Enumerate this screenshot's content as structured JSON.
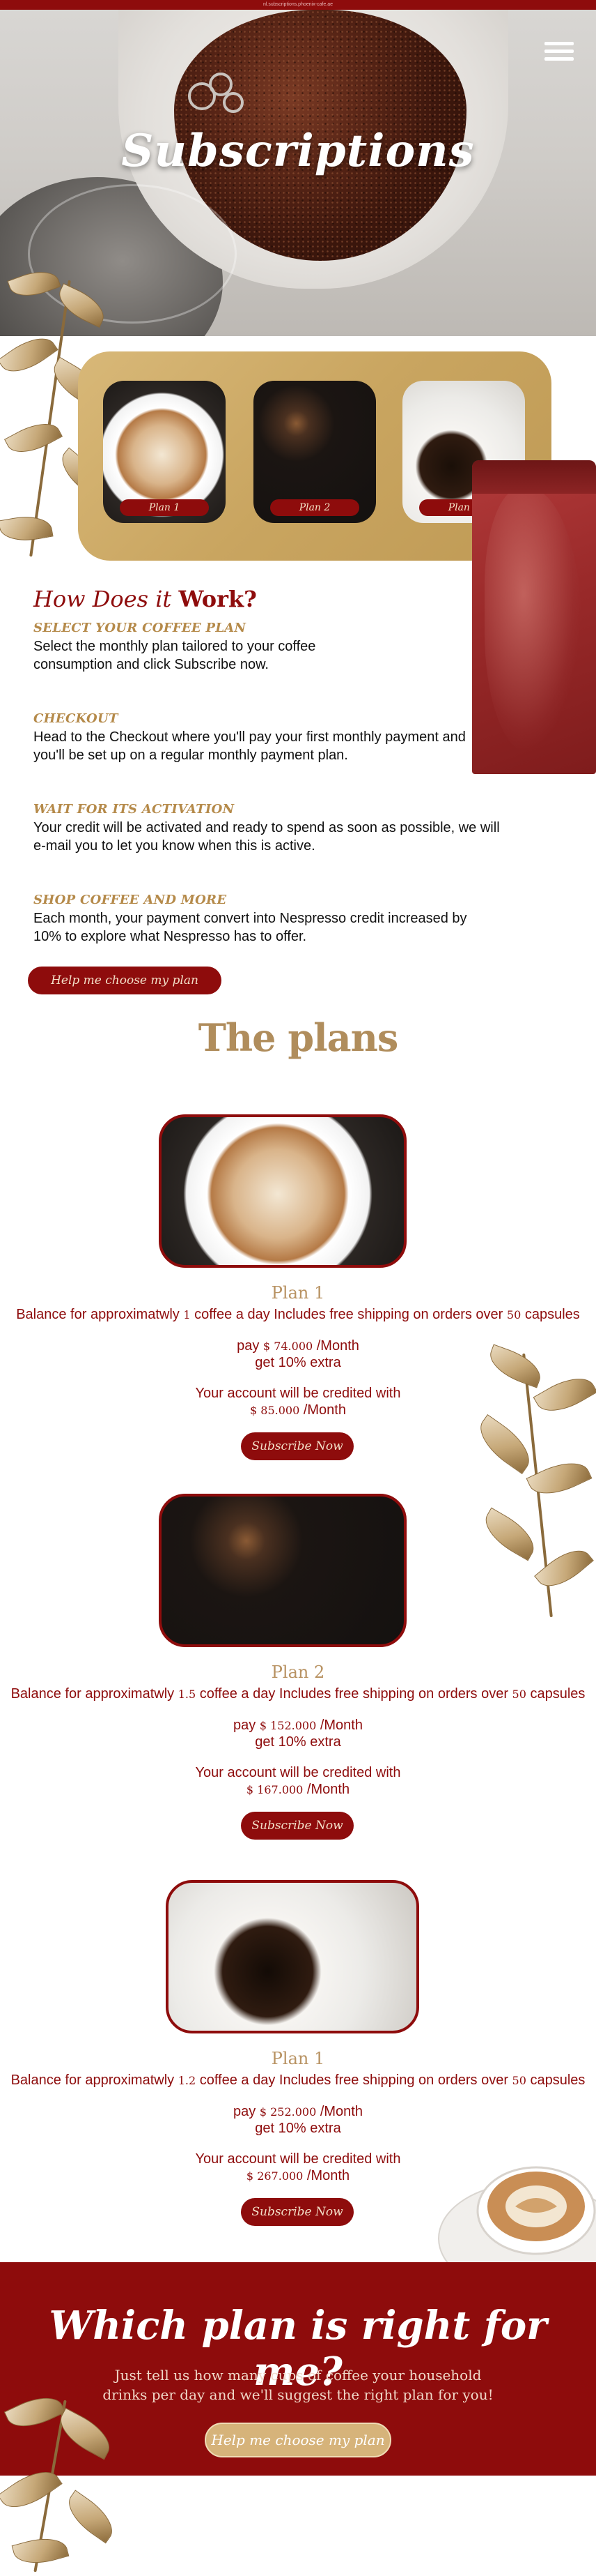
{
  "topbar": {
    "text": "nl.subscriptions.phoenix-cafe.ae"
  },
  "hero": {
    "title": "Subscriptions",
    "menu_icon": "hamburger-menu-icon"
  },
  "preview": {
    "plans": [
      {
        "label": "Plan 1",
        "photo": "latte-art-cup"
      },
      {
        "label": "Plan 2",
        "photo": "coffee-beans-spoon"
      },
      {
        "label": "Plan 3",
        "photo": "pour-over-coffee"
      }
    ]
  },
  "how": {
    "title_part1": "How Does it",
    "title_part2": "Work?",
    "steps": [
      {
        "heading": "SELECT YOUR COFFEE PLAN",
        "text": "Select the monthly plan tailored to your coffee consumption and click Subscribe now."
      },
      {
        "heading": "CHECKOUT",
        "text": "Head to the Checkout where you'll pay your first monthly payment and you'll be set up on a regular monthly payment plan."
      },
      {
        "heading": "WAIT FOR ITS ACTIVATION",
        "text": "Your credit will be activated and ready to spend as soon as possible, we will e-mail you to let you know when this is active."
      },
      {
        "heading": "SHOP COFFEE AND MORE",
        "text": "Each month, your payment convert into Nespresso credit increased by 10% to explore what Nespresso has to offer."
      }
    ],
    "help_button": "Help me choose my plan"
  },
  "plans_title": "The plans",
  "plans": [
    {
      "name": "Plan 1",
      "desc_pre": "Balance for approximatwly",
      "cups": "1",
      "desc_mid": "coffee a day Includes free shipping on orders over",
      "threshold": "50",
      "desc_post": "capsules",
      "pay_pre": "pay",
      "pay_amount": "$ 74.000",
      "pay_post": "/Month",
      "extra": "get 10% extra",
      "credit_label": "Your account will be credited with",
      "credit_amount": "$ 85.000",
      "credit_post": "/Month",
      "button": "Subscribe Now"
    },
    {
      "name": "Plan 2",
      "desc_pre": "Balance for approximatwly",
      "cups": "1.5",
      "desc_mid": "coffee a day Includes free shipping on orders over",
      "threshold": "50",
      "desc_post": "capsules",
      "pay_pre": "pay",
      "pay_amount": "$ 152.000",
      "pay_post": "/Month",
      "extra": "get 10% extra",
      "credit_label": "Your account will be credited with",
      "credit_amount": "$ 167.000",
      "credit_post": "/Month",
      "button": "Subscribe Now"
    },
    {
      "name": "Plan 1",
      "desc_pre": "Balance for approximatwly",
      "cups": "1.2",
      "desc_mid": "coffee a day Includes free shipping on orders over",
      "threshold": "50",
      "desc_post": "capsules",
      "pay_pre": "pay",
      "pay_amount": "$ 252.000",
      "pay_post": "/Month",
      "extra": "get 10% extra",
      "credit_label": "Your account will be credited with",
      "credit_amount": "$ 267.000",
      "credit_post": "/Month",
      "button": "Subscribe Now"
    }
  ],
  "footer": {
    "title": "Which plan is right for me?",
    "sub_line1": "Just tell us how many cups of coffee your household",
    "sub_line2": "drinks per day and we'll suggest the right plan for you!",
    "button": "Help me choose my plan"
  },
  "colors": {
    "brand_red": "#8e0c0c",
    "gold": "#b58a4a",
    "card_gold": "#c9a560"
  }
}
